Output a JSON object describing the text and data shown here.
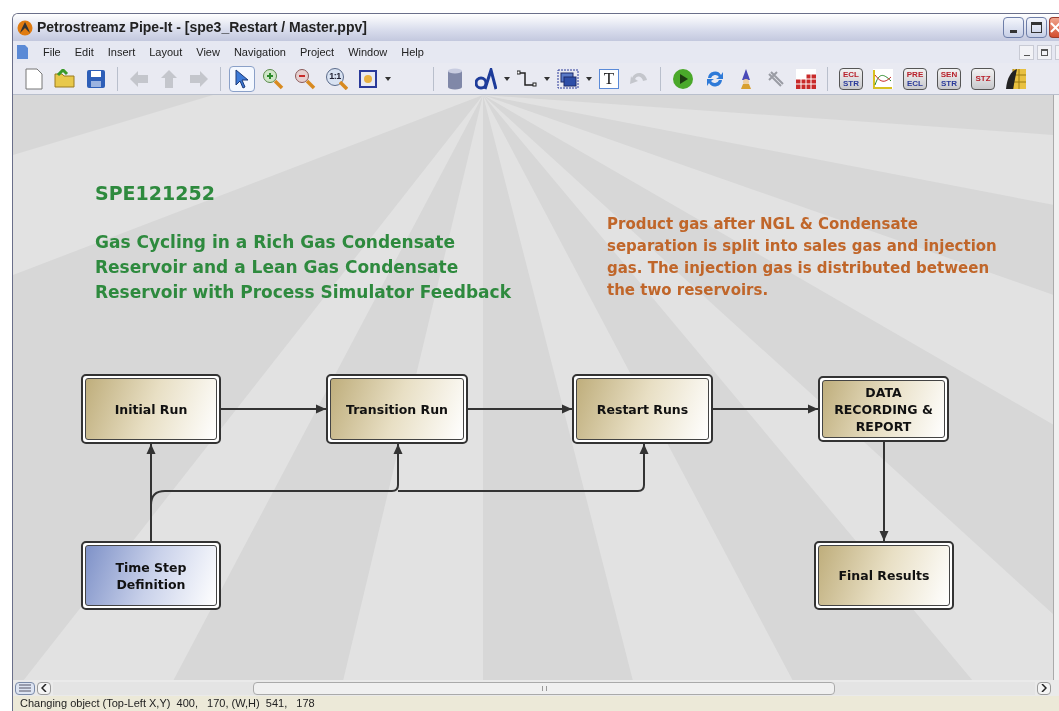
{
  "window": {
    "title": "Petrostreamz Pipe-It - [spe3_Restart / Master.ppv]"
  },
  "menu": [
    "File",
    "Edit",
    "Insert",
    "Layout",
    "View",
    "Navigation",
    "Project",
    "Window",
    "Help"
  ],
  "toolbar": {
    "pointer_selected": true,
    "zoom_label": "1:1",
    "text_tool": "T",
    "badges": [
      {
        "top": "ECL",
        "bottom": "STR"
      },
      {
        "top": "PRE",
        "bottom": "ECL"
      },
      {
        "top": "SEN",
        "bottom": "STR"
      },
      {
        "top": "STZ"
      }
    ]
  },
  "diagram": {
    "heading": "SPE121252",
    "title_lines": [
      "Gas Cycling in a Rich Gas Condensate",
      "Reservoir and a Lean Gas Condensate",
      "Reservoir with Process Simulator Feedback"
    ],
    "note_lines": [
      "Product gas after NGL & Condensate",
      "separation is split into sales gas and injection",
      "gas. The injection gas is distributed between",
      "the two reservoirs."
    ],
    "nodes": [
      {
        "label": "Initial Run",
        "kind": "process"
      },
      {
        "label": "Transition Run",
        "kind": "process"
      },
      {
        "label": "Restart Runs",
        "kind": "process"
      },
      {
        "label": "DATA RECORDING & REPORT",
        "kind": "process"
      },
      {
        "label": "Time Step Definition",
        "kind": "input"
      },
      {
        "label": "Final Results",
        "kind": "process"
      }
    ]
  },
  "status_bar": "Changing object (Top-Left X,Y)  400,   170, (W,H)  541,   178"
}
